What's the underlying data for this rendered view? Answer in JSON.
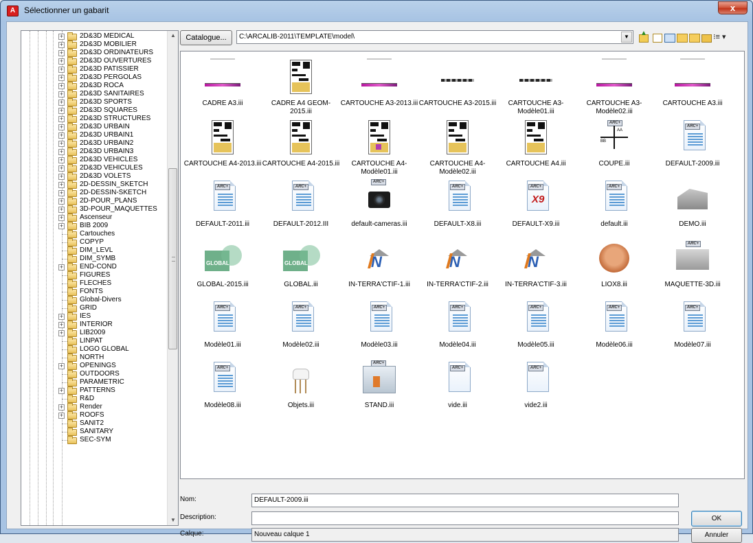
{
  "window": {
    "title": "Sélectionner un gabarit",
    "close_symbol": "x",
    "app_icon_glyph": "A"
  },
  "tree": {
    "items": [
      {
        "label": "2D&3D MEDICAL",
        "expandable": true
      },
      {
        "label": "2D&3D MOBILIER",
        "expandable": true
      },
      {
        "label": "2D&3D ORDINATEURS",
        "expandable": true
      },
      {
        "label": "2D&3D OUVERTURES",
        "expandable": true
      },
      {
        "label": "2D&3D PATISSIER",
        "expandable": true
      },
      {
        "label": "2D&3D PERGOLAS",
        "expandable": true
      },
      {
        "label": "2D&3D ROCA",
        "expandable": true
      },
      {
        "label": "2D&3D SANITAIRES",
        "expandable": true
      },
      {
        "label": "2D&3D SPORTS",
        "expandable": true
      },
      {
        "label": "2D&3D SQUARES",
        "expandable": true
      },
      {
        "label": "2D&3D STRUCTURES",
        "expandable": true
      },
      {
        "label": "2D&3D URBAIN",
        "expandable": true
      },
      {
        "label": "2D&3D URBAIN1",
        "expandable": true
      },
      {
        "label": "2D&3D URBAIN2",
        "expandable": true
      },
      {
        "label": "2D&3D URBAIN3",
        "expandable": true
      },
      {
        "label": "2D&3D VEHICLES",
        "expandable": true
      },
      {
        "label": "2D&3D VEHICULES",
        "expandable": true
      },
      {
        "label": "2D&3D VOLETS",
        "expandable": true
      },
      {
        "label": "2D-DESSIN_SKETCH",
        "expandable": true
      },
      {
        "label": "2D-DESSIN-SKETCH",
        "expandable": true
      },
      {
        "label": "2D-POUR_PLANS",
        "expandable": true
      },
      {
        "label": "3D-POUR_MAQUETTES",
        "expandable": true
      },
      {
        "label": "Ascenseur",
        "expandable": true
      },
      {
        "label": "BIB 2009",
        "expandable": true
      },
      {
        "label": "Cartouches",
        "expandable": false
      },
      {
        "label": "COPYP",
        "expandable": false
      },
      {
        "label": "DIM_LEVL",
        "expandable": false
      },
      {
        "label": "DIM_SYMB",
        "expandable": false
      },
      {
        "label": "END-COND",
        "expandable": true
      },
      {
        "label": "FIGURES",
        "expandable": false
      },
      {
        "label": "FLECHES",
        "expandable": false
      },
      {
        "label": "FONTS",
        "expandable": false
      },
      {
        "label": "Global-Divers",
        "expandable": false
      },
      {
        "label": "GRID",
        "expandable": false
      },
      {
        "label": "IES",
        "expandable": true
      },
      {
        "label": "INTERIOR",
        "expandable": true
      },
      {
        "label": "LIB2009",
        "expandable": true
      },
      {
        "label": "LINPAT",
        "expandable": false
      },
      {
        "label": "LOGO GLOBAL",
        "expandable": false
      },
      {
        "label": "NORTH",
        "expandable": false
      },
      {
        "label": "OPENINGS",
        "expandable": true
      },
      {
        "label": "OUTDOORS",
        "expandable": false
      },
      {
        "label": "PARAMETRIC",
        "expandable": false
      },
      {
        "label": "PATTERNS",
        "expandable": true
      },
      {
        "label": "R&D",
        "expandable": false
      },
      {
        "label": "Render",
        "expandable": true
      },
      {
        "label": "ROOFS",
        "expandable": true
      },
      {
        "label": "SANIT2",
        "expandable": false
      },
      {
        "label": "SANITARY",
        "expandable": false
      },
      {
        "label": "SEC-SYM",
        "expandable": false
      }
    ],
    "expand_symbol": "+",
    "scroll_up": "▲",
    "scroll_down": "▼"
  },
  "toolbar": {
    "catalogue_label": "Catalogue...",
    "path_value": "C:\\ARCALIB-2011\\TEMPLATE\\model\\",
    "combo_arrow": "▼",
    "view_menu": "⁝≡ ▾",
    "icons": [
      "folder-up-icon",
      "new-folder-icon",
      "catalog-book-icon",
      "open-folder-icon",
      "search-folder-icon",
      "folder-icon",
      "view-menu-icon"
    ]
  },
  "files": [
    {
      "label": "CADRE A3.iii",
      "thumb": "strip"
    },
    {
      "label": "CADRE A4 GEOM-2015.iii",
      "thumb": "sheet"
    },
    {
      "label": "CARTOUCHE A3-2013.iii",
      "thumb": "strip"
    },
    {
      "label": "CARTOUCHE A3-2015.iii",
      "thumb": "strip2"
    },
    {
      "label": "CARTOUCHE A3-Modèle01.iii",
      "thumb": "strip2"
    },
    {
      "label": "CARTOUCHE A3-Modèle02.iii",
      "thumb": "strip"
    },
    {
      "label": "CARTOUCHE A3.iii",
      "thumb": "strip"
    },
    {
      "label": "CARTOUCHE A4-2013.iii",
      "thumb": "sheet"
    },
    {
      "label": "CARTOUCHE A4-2015.iii",
      "thumb": "sheet"
    },
    {
      "label": "CARTOUCHE A4-Modèle01.iii",
      "thumb": "sheet-purple"
    },
    {
      "label": "CARTOUCHE A4-Modèle02.iii",
      "thumb": "sheet"
    },
    {
      "label": "CARTOUCHE A4.iii",
      "thumb": "sheet"
    },
    {
      "label": "COUPE.iii",
      "thumb": "section"
    },
    {
      "label": "DEFAULT-2009.iii",
      "thumb": "doc"
    },
    {
      "label": "DEFAULT-2011.iii",
      "thumb": "doc"
    },
    {
      "label": "DEFAULT-2012.III",
      "thumb": "doc"
    },
    {
      "label": "default-cameras.iii",
      "thumb": "camera"
    },
    {
      "label": "DEFAULT-X8.iii",
      "thumb": "doc"
    },
    {
      "label": "DEFAULT-X9.iii",
      "thumb": "doc-x9"
    },
    {
      "label": "default.iii",
      "thumb": "doc"
    },
    {
      "label": "DEMO.iii",
      "thumb": "building"
    },
    {
      "label": "GLOBAL-2015.iii",
      "thumb": "global"
    },
    {
      "label": "GLOBAL.iii",
      "thumb": "global"
    },
    {
      "label": "IN-TERRA'CTIF-1.iii",
      "thumb": "terra"
    },
    {
      "label": "IN-TERRA'CTIF-2.iii",
      "thumb": "terra"
    },
    {
      "label": "IN-TERRA'CTIF-3.iii",
      "thumb": "terra"
    },
    {
      "label": "LIOX8.iii",
      "thumb": "face"
    },
    {
      "label": "MAQUETTE-3D.iii",
      "thumb": "maquette"
    },
    {
      "label": "Modèle01.iii",
      "thumb": "doc"
    },
    {
      "label": "Modèle02.iii",
      "thumb": "doc"
    },
    {
      "label": "Modèle03.iii",
      "thumb": "doc"
    },
    {
      "label": "Modèle04.iii",
      "thumb": "doc"
    },
    {
      "label": "Modèle05.iii",
      "thumb": "doc"
    },
    {
      "label": "Modèle06.iii",
      "thumb": "doc"
    },
    {
      "label": "Modèle07.iii",
      "thumb": "doc"
    },
    {
      "label": "Modèle08.iii",
      "thumb": "doc"
    },
    {
      "label": "Objets.iii",
      "thumb": "chair"
    },
    {
      "label": "STAND.iii",
      "thumb": "stand"
    },
    {
      "label": "vide.iii",
      "thumb": "blank"
    },
    {
      "label": "vide2.iii",
      "thumb": "blank"
    }
  ],
  "thumb_text": {
    "arc_badge": "ARC+",
    "global_text": "GLOBAL",
    "x9_text": "X9",
    "terra_text": "N",
    "section_a": "AA",
    "section_b": "BB"
  },
  "form": {
    "name_label": "Nom:",
    "name_value": "DEFAULT-2009.iii",
    "description_label": "Description:",
    "description_value": "",
    "layer_label": "Calque:",
    "layer_value": "Nouveau calque 1",
    "ok_label": "OK",
    "cancel_label": "Annuler"
  }
}
